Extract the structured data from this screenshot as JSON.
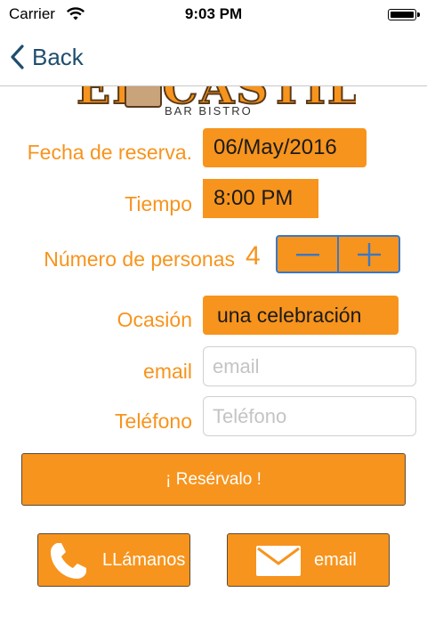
{
  "status_bar": {
    "carrier": "Carrier",
    "time": "9:03 PM"
  },
  "nav": {
    "back_label": "Back"
  },
  "logo": {
    "name": "EL CASTILLO",
    "subtitle": "BAR BISTRO"
  },
  "form": {
    "date_label": "Fecha de reserva.",
    "date_value": "06/May/2016",
    "time_label": "Tiempo",
    "time_value": "8:00 PM",
    "people_label": "Número de personas",
    "people_value": "4",
    "occasion_label": "Ocasión",
    "occasion_value": "una celebración",
    "email_label": "email",
    "email_placeholder": "email",
    "phone_label": "Teléfono",
    "phone_placeholder": "Teléfono"
  },
  "buttons": {
    "reserve": "¡ Resérvalo !",
    "call": "LLámanos",
    "email": "email"
  },
  "colors": {
    "accent": "#f7941d",
    "nav_blue": "#1f4e6e",
    "stepper_blue": "#3a78c8"
  },
  "icons": {
    "back": "chevron-left-icon",
    "minus": "minus-icon",
    "plus": "plus-icon",
    "phone": "phone-icon",
    "mail": "mail-icon"
  }
}
